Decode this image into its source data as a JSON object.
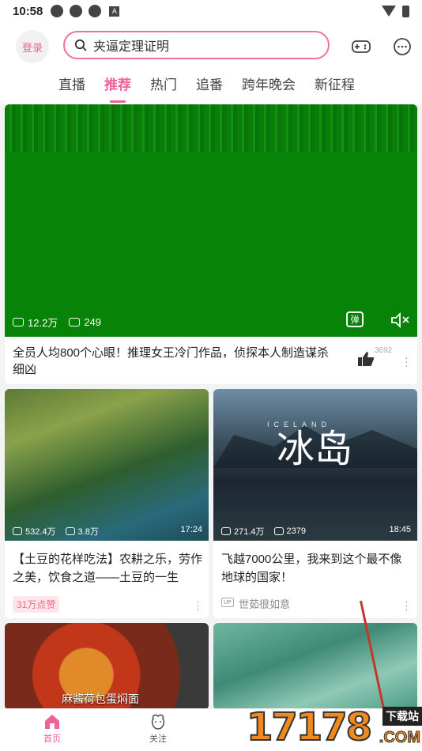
{
  "status_bar": {
    "time": "10:58"
  },
  "header": {
    "login_label": "登录",
    "search_placeholder": "夹逼定理证明"
  },
  "tabs": [
    {
      "label": "直播"
    },
    {
      "label": "推荐"
    },
    {
      "label": "热门"
    },
    {
      "label": "追番"
    },
    {
      "label": "跨年晚会"
    },
    {
      "label": "新征程"
    }
  ],
  "active_tab": "推荐",
  "featured": {
    "play_count": "12.2万",
    "danmaku_count": "249",
    "danmaku_toggle": "弹",
    "title": "全员人均800个心眼！推理女王冷门作品，侦探本人制造谋杀细凶",
    "likes": "3692"
  },
  "cards": [
    {
      "play_count": "532.4万",
      "danmaku_count": "3.8万",
      "duration": "17:24",
      "title": "【土豆的花样吃法】农耕之乐，劳作之美，饮食之道——土豆的一生",
      "badge": "31万点赞"
    },
    {
      "thumb_caption": "冰岛",
      "thumb_subcaption": "ICELAND",
      "play_count": "271.4万",
      "danmaku_count": "2379",
      "duration": "18:45",
      "title": "飞越7000公里，我来到这个最不像地球的国家！",
      "up_tag": "UP",
      "author": "世茹很如意"
    },
    {
      "thumb_caption": "麻酱荷包蛋焖面"
    },
    {}
  ],
  "bottom_nav": [
    {
      "label": "首页"
    },
    {
      "label": "关注"
    }
  ],
  "watermark": {
    "digits": "17178",
    "label": "下载站",
    "suffix": ".COM"
  },
  "colors": {
    "accent": "#f0609a",
    "featured_bg": "#078307"
  }
}
